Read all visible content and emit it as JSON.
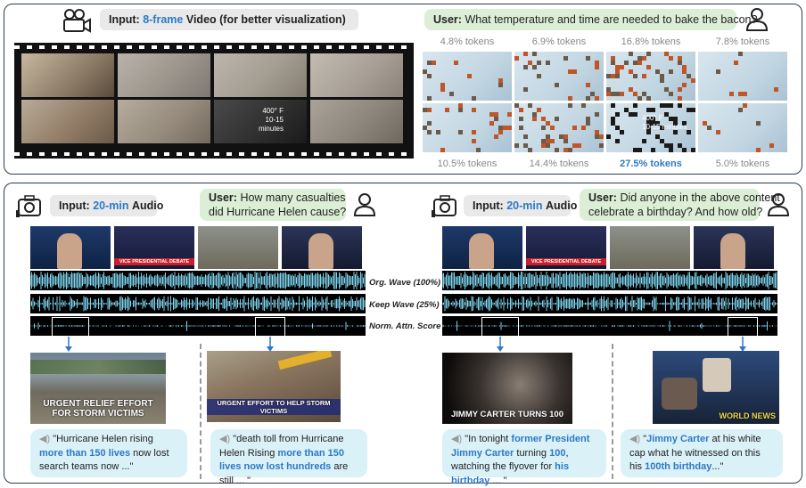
{
  "top": {
    "input_prefix": "Input",
    "input_highlight": "8-frame",
    "input_suffix": "Video (for better visualization)",
    "user_prefix": "User",
    "question": "What temperature and time are needed to bake the bacon?",
    "overlay_temp": "400° F",
    "overlay_time": "10-15 minutes",
    "tokens_row1": [
      "4.8% tokens",
      "6.9% tokens",
      "16.8% tokens",
      "7.8% tokens"
    ],
    "tokens_row2": [
      "10.5% tokens",
      "14.4% tokens",
      "27.5% tokens",
      "5.0% tokens"
    ],
    "highlight_token_index": 6
  },
  "left": {
    "input_prefix": "Input",
    "input_highlight": "20-min",
    "input_suffix": "Audio",
    "user_prefix": "User:",
    "question_line1": "How many casualties",
    "question_line2": "did Hurricane Helen cause?",
    "quote1": {
      "pre": "\"Hurricane Helen rising ",
      "hl1": "more than  150 lives",
      "post": " now lost search teams now ...\""
    },
    "quote2": {
      "pre": "\"death toll from Hurricane Helen Rising ",
      "hl1": "more than 150 lives now lost hundreds",
      "post": " are still ... \""
    },
    "thumb1_caption": "URGENT RELIEF EFFORT FOR STORM VICTIMS",
    "thumb2_caption": "URGENT EFFORT TO HELP STORM VICTIMS"
  },
  "right": {
    "input_prefix": "Input",
    "input_highlight": "20-min",
    "input_suffix": "Audio",
    "user_prefix": "User:",
    "question_line1": "Did anyone in the above content",
    "question_line2": "celebrate a birthday? And how old?",
    "quote1": {
      "pre": "\"In tonight ",
      "hl1": "former President Jimmy Carter",
      "mid": " turning ",
      "hl2": "100",
      "mid2": ", watching the flyover for ",
      "hl3": "his birthday",
      "post": " ... \""
    },
    "quote2": {
      "pre": "\"",
      "hl1": "Jimmy Carter",
      "mid": " at his white cap what he witnessed on this his ",
      "hl2": "100th birthday",
      "post": "...\""
    },
    "thumb1_caption": "JIMMY CARTER TURNS 100",
    "thumb2_caption": "WORLD NEWS"
  },
  "wave_labels": [
    "Org. Wave (100%)",
    "Keep Wave (25%)",
    "Norm. Attn. Score"
  ],
  "news_banner": "VICE PRESIDENTIAL DEBATE",
  "colors": {
    "accent": "#2d79c7",
    "wave": "#7fd6f0",
    "panel": "#2d3b55"
  }
}
